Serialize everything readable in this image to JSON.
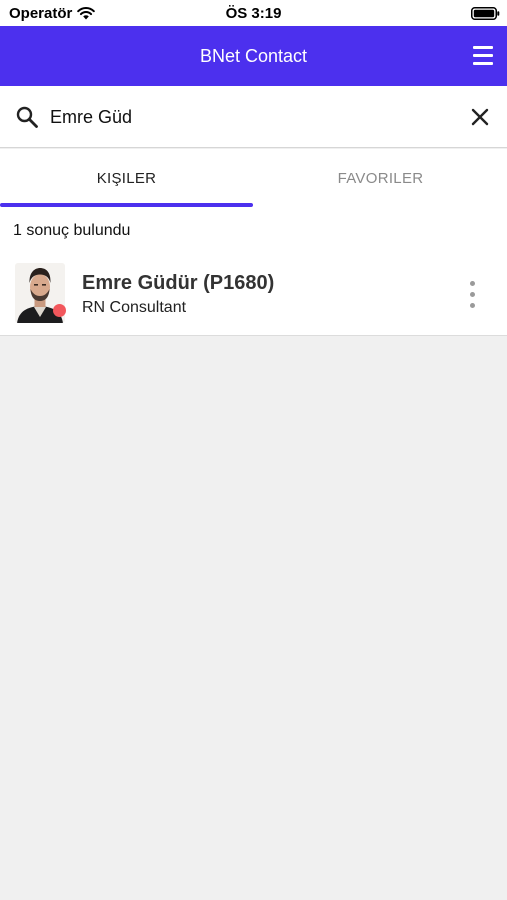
{
  "status_bar": {
    "carrier": "Operatör",
    "time": "ÖS 3:19"
  },
  "app_bar": {
    "title": "BNet Contact"
  },
  "search": {
    "value": "Emre Güd",
    "placeholder": ""
  },
  "tabs": [
    {
      "label": "KIŞILER",
      "active": true
    },
    {
      "label": "FAVORILER",
      "active": false
    }
  ],
  "results": {
    "count_text": "1 sonuç bulundu",
    "contacts": [
      {
        "name": "Emre Güdür (P1680)",
        "title": "RN Consultant",
        "status_color": "#f2575c"
      }
    ]
  },
  "colors": {
    "accent": "#4c30ee",
    "background": "#f0f0f0",
    "status_offline": "#f2575c"
  },
  "icons": [
    "wifi-icon",
    "battery-icon",
    "menu-icon",
    "search-icon",
    "close-icon",
    "more-vertical-icon"
  ]
}
